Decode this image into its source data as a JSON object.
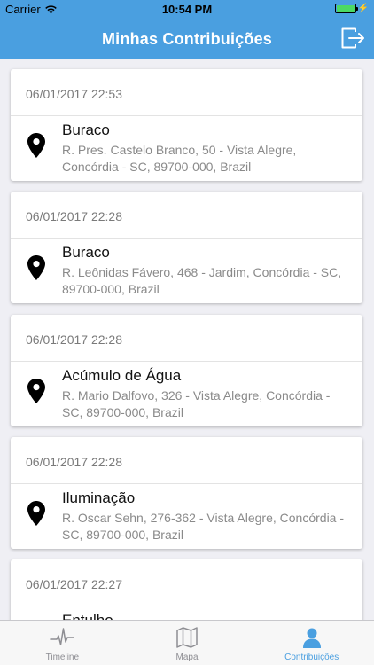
{
  "status_bar": {
    "carrier": "Carrier",
    "time": "10:54 PM",
    "battery_level": 1.0
  },
  "nav": {
    "title": "Minhas Contribuições",
    "logout_icon": "logout-icon"
  },
  "contributions": [
    {
      "date": "06/01/2017 22:53",
      "title": "Buraco",
      "address": "R. Pres. Castelo Branco, 50 - Vista Alegre, Concórdia - SC, 89700-000, Brazil"
    },
    {
      "date": "06/01/2017 22:28",
      "title": "Buraco",
      "address": "R. Leônidas Fávero, 468 - Jardim, Concórdia - SC, 89700-000, Brazil"
    },
    {
      "date": "06/01/2017 22:28",
      "title": "Acúmulo de Água",
      "address": "R. Mario Dalfovo, 326 - Vista Alegre, Concórdia - SC, 89700-000, Brazil"
    },
    {
      "date": "06/01/2017 22:28",
      "title": "Iluminação",
      "address": "R. Oscar Sehn, 276-362 - Vista Alegre, Concórdia - SC, 89700-000, Brazil"
    },
    {
      "date": "06/01/2017 22:27",
      "title": "Entulho",
      "address": ""
    }
  ],
  "tabs": [
    {
      "label": "Timeline",
      "icon": "pulse-icon",
      "active": false
    },
    {
      "label": "Mapa",
      "icon": "map-icon",
      "active": false
    },
    {
      "label": "Contribuições",
      "icon": "user-icon",
      "active": true
    }
  ],
  "colors": {
    "primary": "#4a9fe0",
    "background": "#efeff4",
    "tab_inactive": "#8e8e93"
  }
}
